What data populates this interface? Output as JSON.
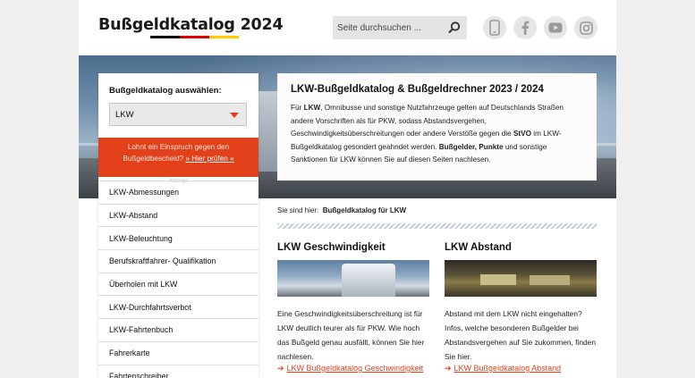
{
  "header": {
    "logo": "Bußgeldkatalog 2024",
    "flag_colors": [
      "#000000",
      "#dd0000",
      "#ffcc00"
    ],
    "search_placeholder": "Seite durchsuchen ...",
    "social": [
      "smartphone-icon",
      "facebook-icon",
      "youtube-icon",
      "instagram-icon"
    ]
  },
  "sidebar": {
    "select_label": "Bußgeldkatalog auswählen:",
    "select_value": "LKW",
    "promo": {
      "text_1": "Lohnt ein Einspruch gegen den",
      "text_2": "Bußgeldbescheid?",
      "link": "» Hier prüfen «",
      "ad_note": "Anzeige"
    },
    "items": [
      "LKW-Abmessungen",
      "LKW-Abstand",
      "LKW-Beleuchtung",
      "Berufskraftfahrer- Qualifikation",
      "Überholen mit LKW",
      "LKW-Durchfahrtsverbot",
      "LKW-Fahrtenbuch",
      "Fahrerkarte",
      "Fahrtenschreiber"
    ]
  },
  "hero": {
    "title": "LKW-Bußgeldkatalog & Bußgeldrechner 2023 / 2024",
    "p1": "Für ",
    "b1": "LKW",
    "p2": ", Omnibusse und sonstige Nutzfahrzeuge gelten auf Deutschlands Straßen andere Vorschriften als für PKW, sodass Abstandsvergehen, Geschwindigkeitsüberschreitungen oder andere Verstöße gegen die ",
    "b2": "StVO",
    "p3": " im LKW-Bußgeldkatalog gesondert geahndet werden. ",
    "b3": "Bußgelder, Punkte",
    "p4": " und sonstige Sanktionen für LKW können Sie auf diesen Seiten nachlesen."
  },
  "breadcrumb": {
    "prefix": "Sie sind hier:",
    "current": "Bußgeldkatalog für LKW"
  },
  "cards": [
    {
      "title": "LKW Geschwindigkeit",
      "text": "Eine Geschwindigkeitsüberschreitung ist für LKW deutlich teurer als für PKW. Wie hoch das Bußgeld genau ausfällt, können Sie hier nachlesen.",
      "link": "LKW Bußgeldkatalog Geschwindigkeit"
    },
    {
      "title": "LKW Abstand",
      "text": "Abstand mit dem LKW nicht eingehalten? Infos, welche besonderen Bußgelder bei Abstandsvergehen auf Sie zukommen, finden Sie hier.",
      "link": "LKW Bußgeldkatalog Abstand"
    }
  ],
  "colors": {
    "accent": "#e2401b",
    "page_bg": "#efefef"
  }
}
